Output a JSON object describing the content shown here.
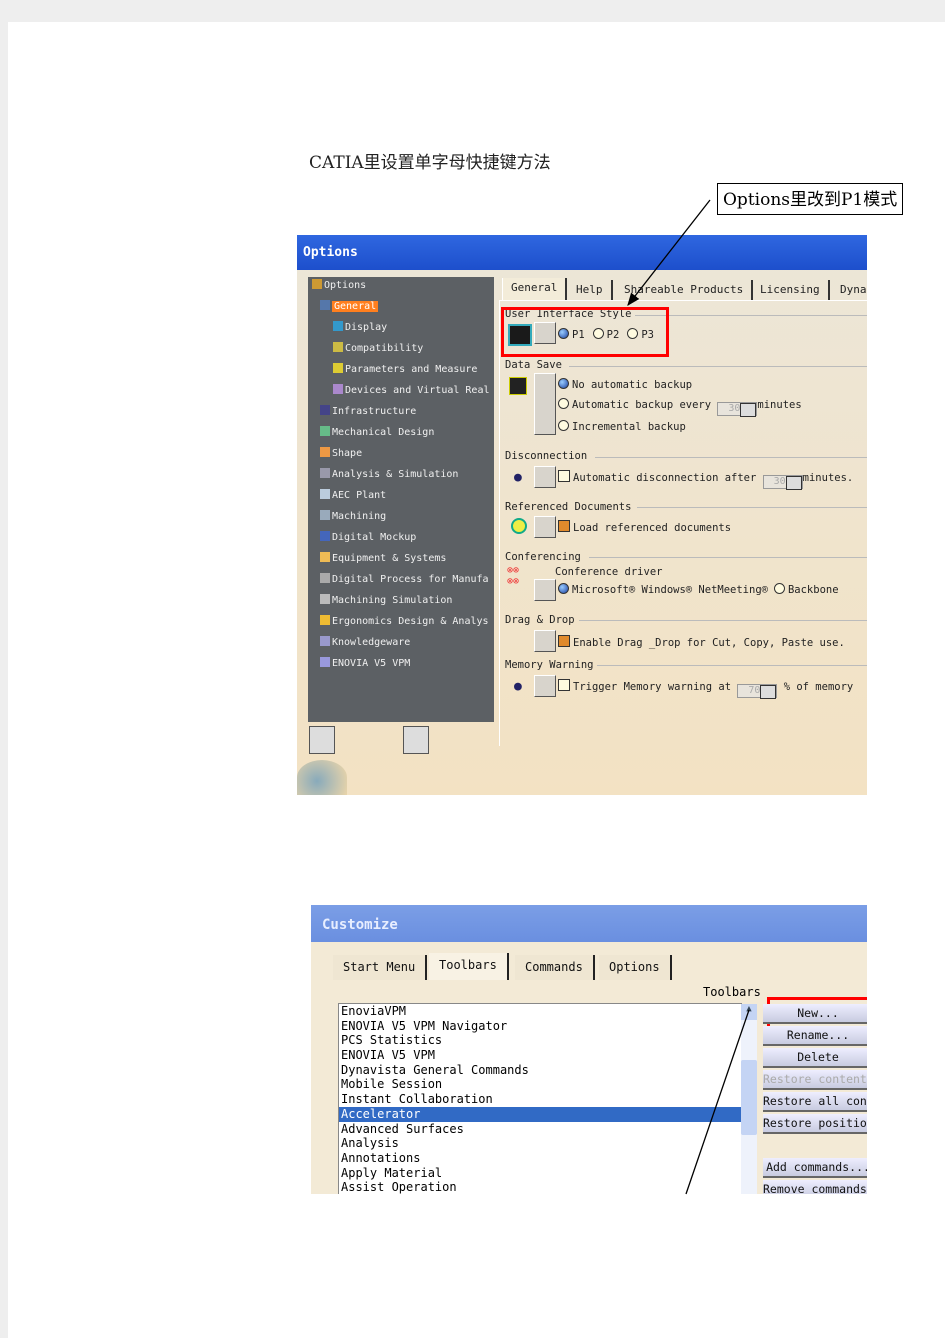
{
  "heading": "CATIA里设置单字母快捷键方法",
  "callout": "Options里改到P1模式",
  "options_dialog": {
    "title": "Options",
    "tree": [
      {
        "label": "Options",
        "level": 0
      },
      {
        "label": "General",
        "level": 1,
        "selected": true
      },
      {
        "label": "Display",
        "level": 2
      },
      {
        "label": "Compatibility",
        "level": 2
      },
      {
        "label": "Parameters and Measure",
        "level": 2
      },
      {
        "label": "Devices and Virtual Real",
        "level": 2
      },
      {
        "label": "Infrastructure",
        "level": 1
      },
      {
        "label": "Mechanical Design",
        "level": 1
      },
      {
        "label": "Shape",
        "level": 1
      },
      {
        "label": "Analysis & Simulation",
        "level": 1
      },
      {
        "label": "AEC Plant",
        "level": 1
      },
      {
        "label": "Machining",
        "level": 1
      },
      {
        "label": "Digital Mockup",
        "level": 1
      },
      {
        "label": "Equipment & Systems",
        "level": 1
      },
      {
        "label": "Digital Process for Manufa",
        "level": 1
      },
      {
        "label": "Machining Simulation",
        "level": 1
      },
      {
        "label": "Ergonomics Design & Analys",
        "level": 1
      },
      {
        "label": "Knowledgeware",
        "level": 1
      },
      {
        "label": "ENOVIA V5 VPM",
        "level": 1
      }
    ],
    "tabs": [
      "General",
      "Help",
      "Shareable Products",
      "Licensing",
      "Dynav"
    ],
    "active_tab": "General",
    "ui_style": {
      "label": "User Interface Style",
      "options": [
        "P1",
        "P2",
        "P3"
      ],
      "selected": "P1"
    },
    "data_save": {
      "label": "Data Save",
      "options": [
        "No automatic backup",
        "Automatic backup every",
        "Incremental backup"
      ],
      "selected": "No automatic backup",
      "interval": "30",
      "unit": "minutes"
    },
    "disconnection": {
      "label": "Disconnection",
      "checkbox": "Automatic disconnection after",
      "checked": false,
      "value": "30",
      "unit": "minutes."
    },
    "referenced": {
      "label": "Referenced Documents",
      "checkbox": "Load referenced documents",
      "checked": true
    },
    "conferencing": {
      "label": "Conferencing",
      "driver_label": "Conference driver",
      "options": [
        "Microsoft® Windows® NetMeeting®",
        "Backbone"
      ],
      "selected": "Microsoft® Windows® NetMeeting®"
    },
    "drag_drop": {
      "label": "Drag & Drop",
      "checkbox": "Enable Drag _Drop for Cut, Copy, Paste use.",
      "checked": true
    },
    "memory": {
      "label": "Memory Warning",
      "checkbox": "Trigger Memory warning at",
      "checked": false,
      "value": "70",
      "unit": "% of memory"
    }
  },
  "customize_dialog": {
    "title": "Customize",
    "tabs": [
      "Start Menu",
      "Toolbars",
      "Commands",
      "Options"
    ],
    "active_tab": "Toolbars",
    "list_label": "Toolbars",
    "toolbars": [
      "EnoviaVPM",
      "ENOVIA V5 VPM Navigator",
      "PCS Statistics",
      "ENOVIA V5 VPM",
      "Dynavista General Commands",
      "Mobile Session",
      "Instant Collaboration",
      "Accelerator",
      "Advanced Surfaces",
      "Analysis",
      "Annotations",
      "Apply Material",
      "Assist Operation"
    ],
    "selected": "Accelerator",
    "buttons": [
      {
        "label": "New...",
        "disabled": false
      },
      {
        "label": "Rename...",
        "disabled": false
      },
      {
        "label": "Delete",
        "disabled": false
      },
      {
        "label": "Restore contents",
        "disabled": true
      },
      {
        "label": "Restore all contents",
        "disabled": false
      },
      {
        "label": "Restore position",
        "disabled": false
      },
      {
        "label": "Add commands...",
        "disabled": false
      },
      {
        "label": "Remove commands...",
        "disabled": false
      }
    ]
  },
  "colors": {
    "highlight": "#f00",
    "titlebar": "#1d4fcc",
    "tree_bg": "#5c6064",
    "selection": "#316ac5"
  }
}
